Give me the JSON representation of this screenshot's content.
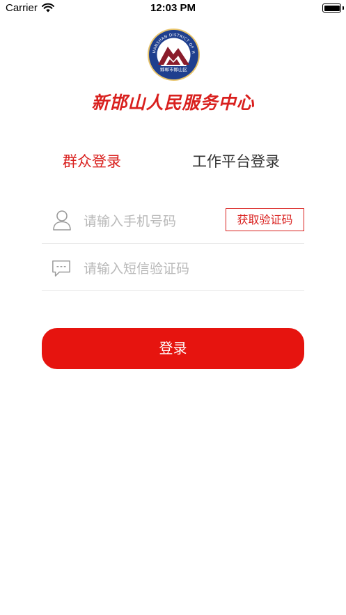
{
  "status_bar": {
    "carrier": "Carrier",
    "time": "12:03 PM"
  },
  "brand": {
    "logo_top_text": "HANSHAN DISTRICT OF HANDAN CITY",
    "logo_bottom_text": "邯郸市邯山区",
    "title": "新邯山人民服务中心",
    "accent_color": "#d9201e"
  },
  "tabs": [
    {
      "label": "群众登录",
      "active": true
    },
    {
      "label": "工作平台登录",
      "active": false
    }
  ],
  "form": {
    "phone": {
      "placeholder": "请输入手机号码",
      "value": "",
      "icon": "user-icon"
    },
    "get_code_label": "获取验证码",
    "sms": {
      "placeholder": "请输入短信验证码",
      "value": "",
      "icon": "message-icon"
    },
    "login_label": "登录",
    "login_color": "#e6140f"
  }
}
